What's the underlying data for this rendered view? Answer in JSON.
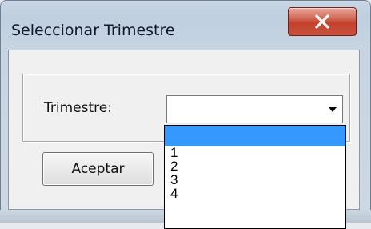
{
  "window": {
    "title": "Seleccionar Trimestre",
    "close_icon": "close-icon"
  },
  "form": {
    "trimestre_label": "Trimestre:",
    "trimestre_value": "",
    "accept_label": "Aceptar"
  },
  "dropdown": {
    "options": [
      "",
      "1",
      "2",
      "3",
      "4"
    ],
    "selected_index": 0
  },
  "colors": {
    "close_button": "#c4402c",
    "selection": "#3399ff"
  }
}
